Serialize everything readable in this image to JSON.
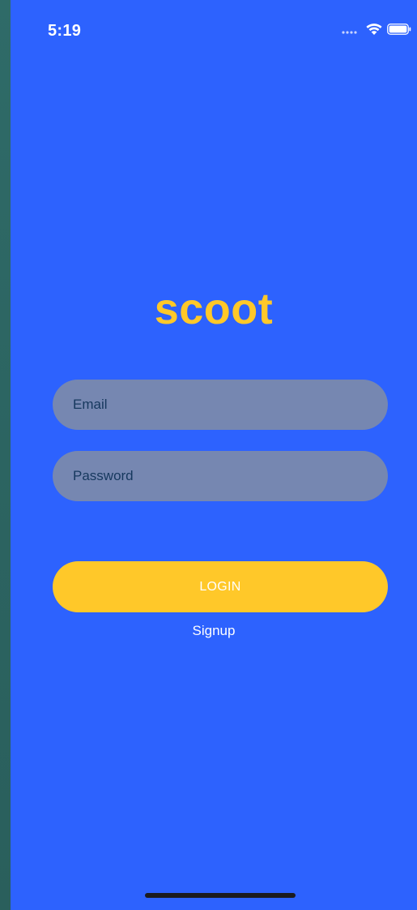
{
  "status_bar": {
    "time": "5:19",
    "icons": [
      "cellular-signal-icon",
      "wifi-icon",
      "battery-icon"
    ]
  },
  "app": {
    "logo_text": "scoot"
  },
  "form": {
    "email_placeholder": "Email",
    "password_placeholder": "Password",
    "login_label": "LOGIN",
    "signup_label": "Signup"
  },
  "colors": {
    "background": "#2d62fe",
    "accent": "#ffc829",
    "field_background": "#7687b1",
    "field_text": "#16385e"
  }
}
